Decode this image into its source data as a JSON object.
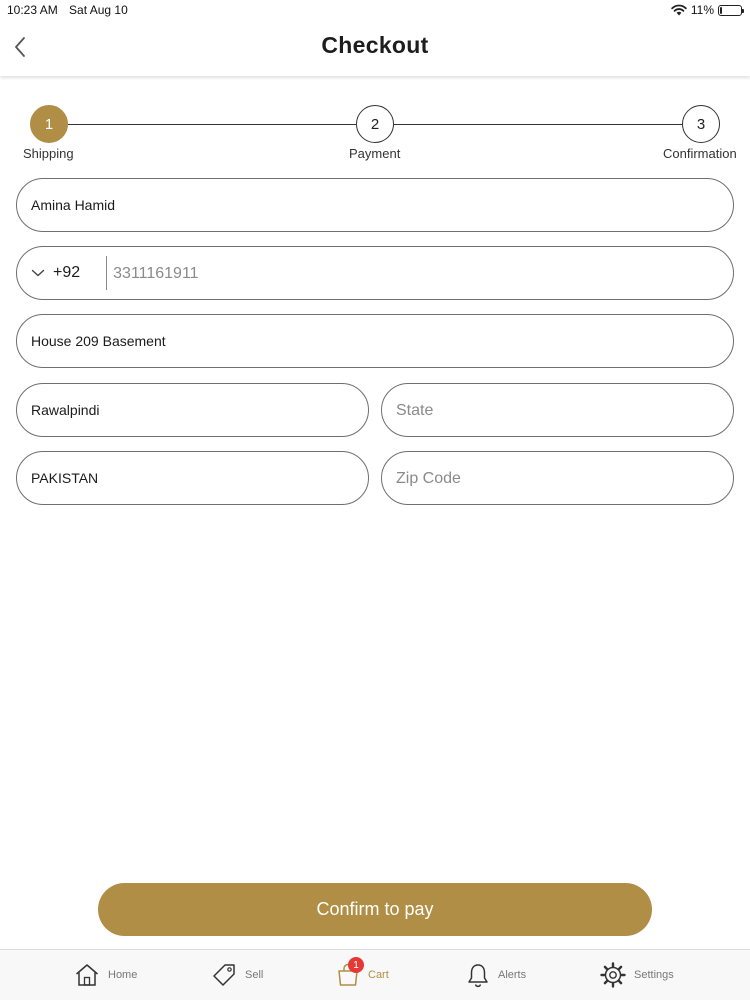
{
  "status_bar": {
    "time": "10:23 AM",
    "date": "Sat Aug 10",
    "battery": "11%",
    "battery_level": 0.11
  },
  "header": {
    "title": "Checkout",
    "back_icon": "chevron-left-icon"
  },
  "stepper": {
    "steps": [
      {
        "number": "1",
        "label": "Shipping",
        "active": true
      },
      {
        "number": "2",
        "label": "Payment",
        "active": false
      },
      {
        "number": "3",
        "label": "Confirmation",
        "active": false
      }
    ]
  },
  "form": {
    "full_name": {
      "value": "Amina Hamid",
      "placeholder": ""
    },
    "phone": {
      "country_code": "+92",
      "value": "",
      "placeholder": "3311161911"
    },
    "address": {
      "value": "House 209 Basement",
      "placeholder": ""
    },
    "city": {
      "value": "Rawalpindi",
      "placeholder": ""
    },
    "state": {
      "value": "",
      "placeholder": "State"
    },
    "country": {
      "value": "PAKISTAN",
      "placeholder": ""
    },
    "zip": {
      "value": "",
      "placeholder": "Zip Code"
    }
  },
  "confirm_button": {
    "label": "Confirm to pay"
  },
  "tab_bar": {
    "tabs": [
      {
        "label": "Home",
        "icon": "home-icon"
      },
      {
        "label": "Sell",
        "icon": "tag-icon"
      },
      {
        "label": "Cart",
        "icon": "cart-icon",
        "badge": "1",
        "active": true
      },
      {
        "label": "Alerts",
        "icon": "bell-icon"
      },
      {
        "label": "Settings",
        "icon": "gear-icon"
      }
    ]
  },
  "colors": {
    "accent": "#b18e45",
    "badge": "#e53935",
    "border": "#6f6f6f"
  }
}
